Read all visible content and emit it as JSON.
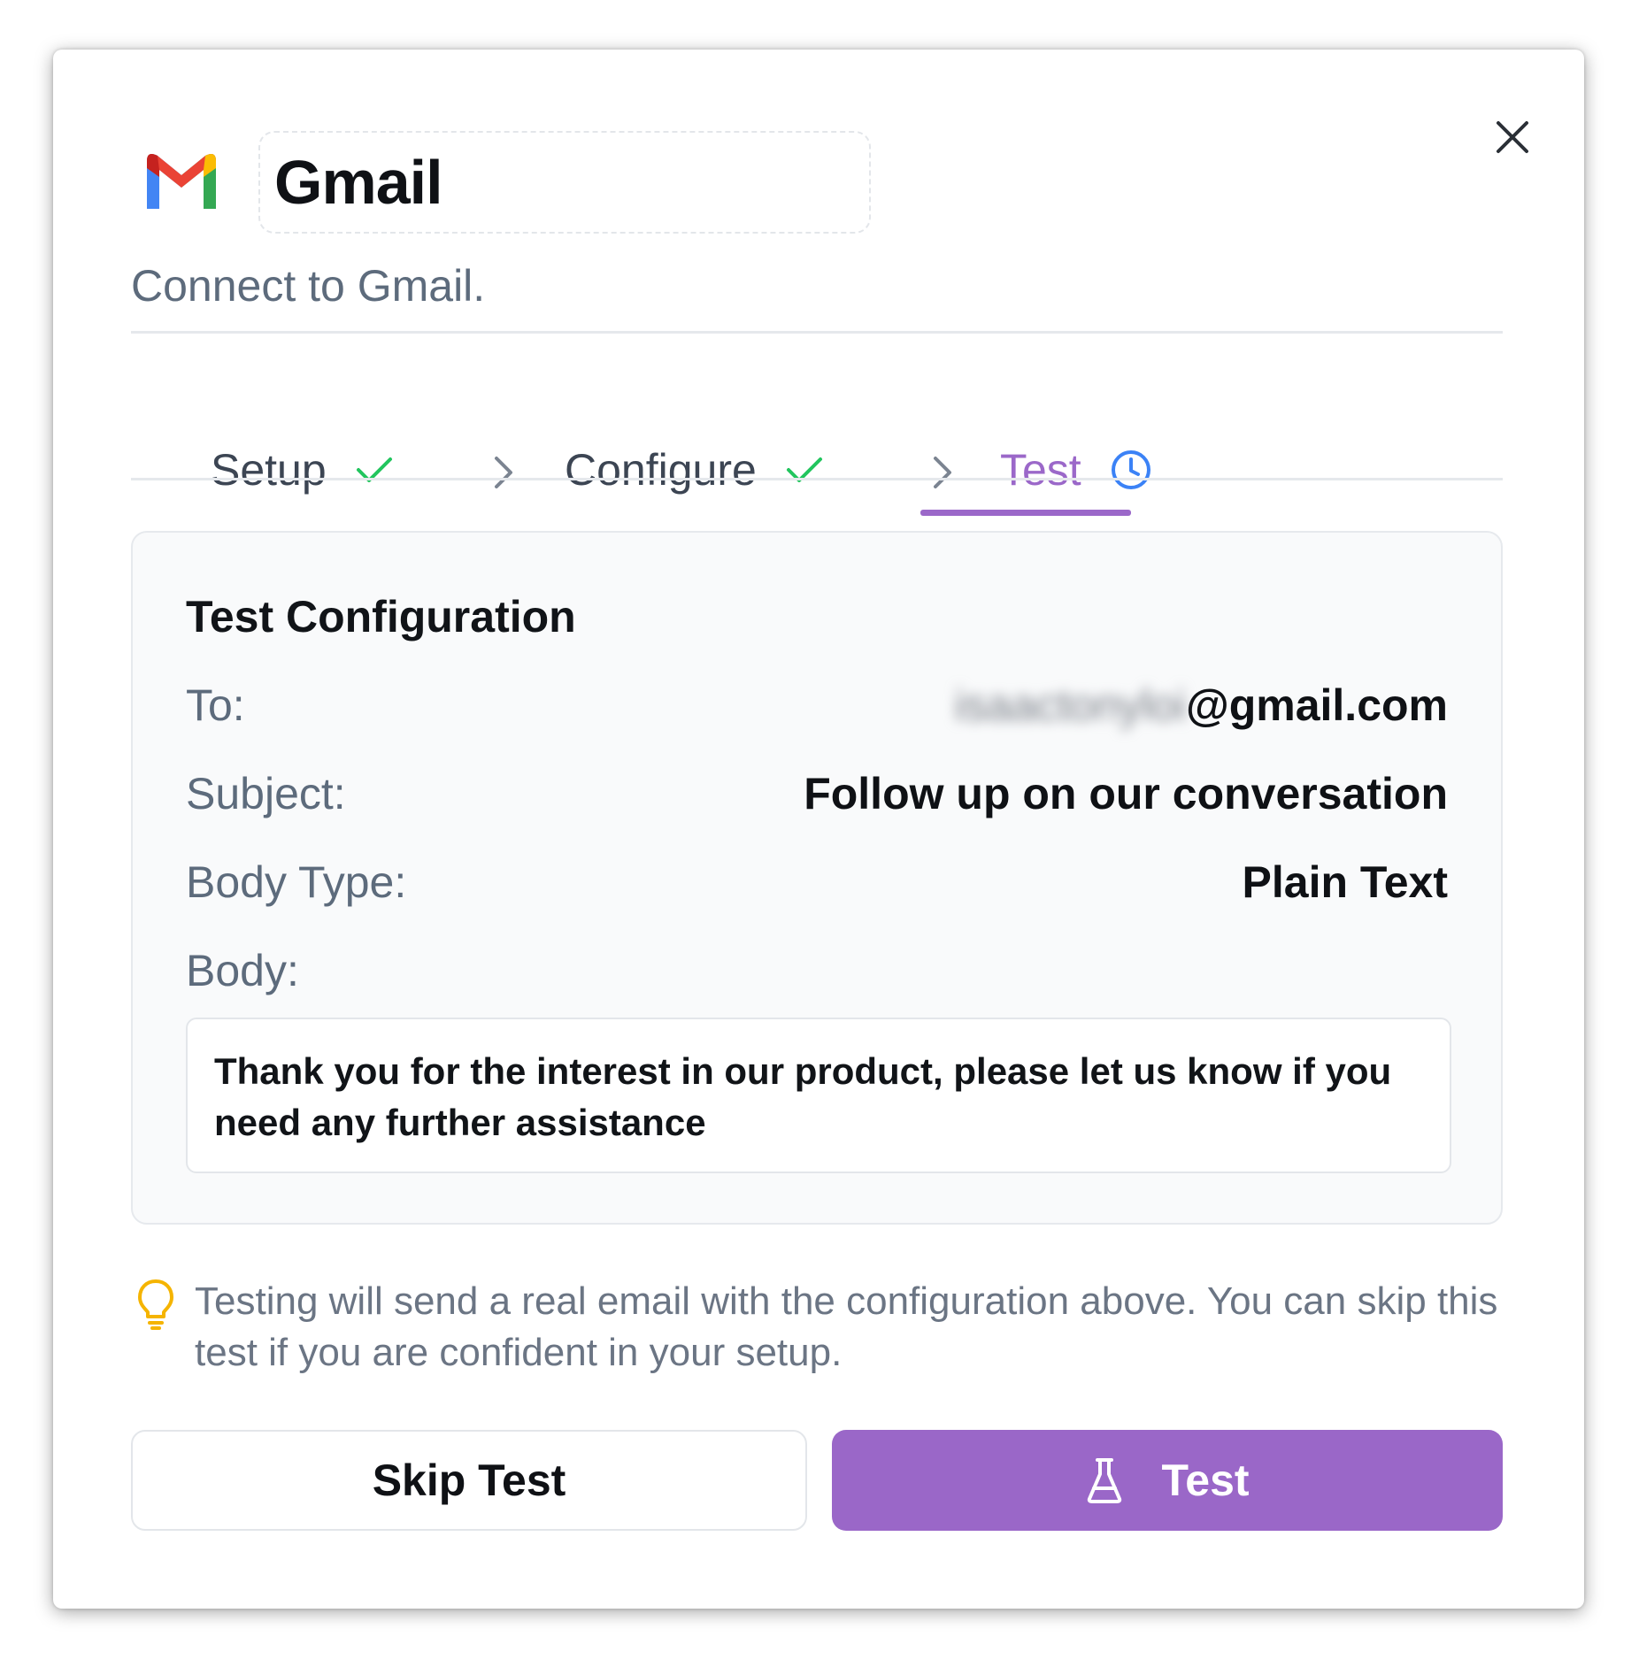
{
  "header": {
    "title": "Gmail",
    "subtitle": "Connect to Gmail."
  },
  "steps": [
    {
      "label": "Setup",
      "status": "complete"
    },
    {
      "label": "Configure",
      "status": "complete"
    },
    {
      "label": "Test",
      "status": "active"
    }
  ],
  "test_config": {
    "title": "Test Configuration",
    "to_label": "To:",
    "to_value_hidden": "isaactonyloi",
    "to_value_domain": "@gmail.com",
    "subject_label": "Subject:",
    "subject_value": "Follow up on our conversation",
    "body_type_label": "Body Type:",
    "body_type_value": "Plain Text",
    "body_label": "Body:",
    "body_value": "Thank you for the interest in our product, please let us know if you need any further assistance"
  },
  "tip": {
    "text": "Testing will send a real email with the configuration above. You can skip this test if you are confident in your setup."
  },
  "actions": {
    "skip_label": "Skip Test",
    "test_label": "Test"
  },
  "colors": {
    "accent": "#9a67c8",
    "check": "#22c55e",
    "clock": "#3b82f6",
    "tip_icon": "#f5b400"
  }
}
